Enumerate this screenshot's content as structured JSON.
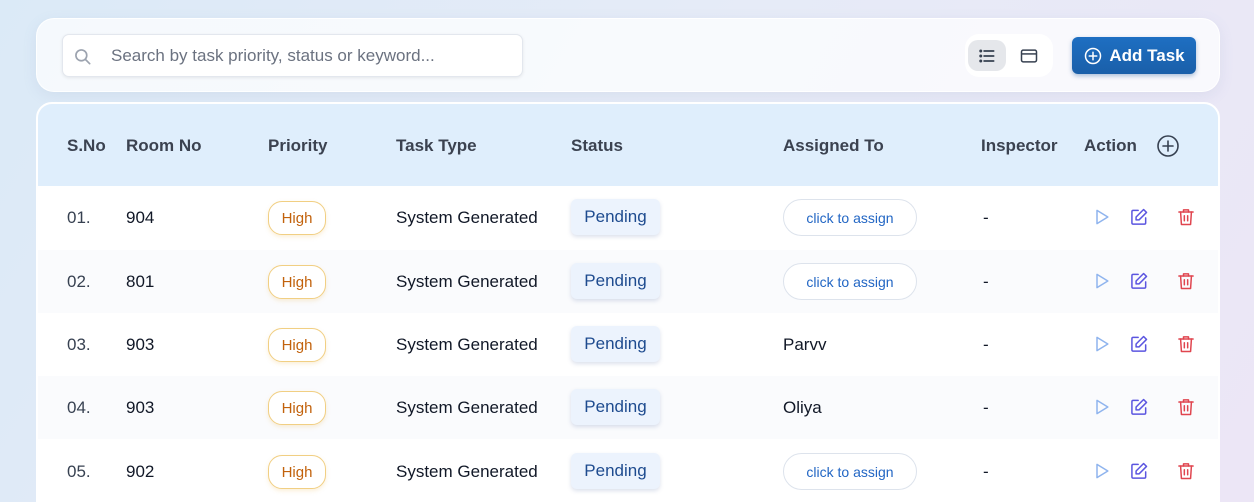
{
  "search": {
    "placeholder": "Search by task priority, status or keyword..."
  },
  "toolbar": {
    "add_label": "Add Task"
  },
  "table": {
    "headers": {
      "sno": "S.No",
      "room": "Room No",
      "priority": "Priority",
      "task_type": "Task Type",
      "status": "Status",
      "assigned": "Assigned To",
      "inspector": "Inspector",
      "action": "Action"
    },
    "rows": [
      {
        "sno": "01.",
        "room": "904",
        "priority": "High",
        "task_type": "System Generated",
        "status": "Pending",
        "assigned": "click to assign",
        "assigned_is_button": true,
        "inspector": "-"
      },
      {
        "sno": "02.",
        "room": "801",
        "priority": "High",
        "task_type": "System Generated",
        "status": "Pending",
        "assigned": "click to assign",
        "assigned_is_button": true,
        "inspector": "-"
      },
      {
        "sno": "03.",
        "room": "903",
        "priority": "High",
        "task_type": "System Generated",
        "status": "Pending",
        "assigned": "Parvv",
        "assigned_is_button": false,
        "inspector": "-"
      },
      {
        "sno": "04.",
        "room": "903",
        "priority": "High",
        "task_type": "System Generated",
        "status": "Pending",
        "assigned": "Oliya",
        "assigned_is_button": false,
        "inspector": "-"
      },
      {
        "sno": "05.",
        "room": "902",
        "priority": "High",
        "task_type": "System Generated",
        "status": "Pending",
        "assigned": "click to assign",
        "assigned_is_button": true,
        "inspector": "-"
      }
    ]
  },
  "icons": {
    "search": "search-icon",
    "list_view": "list-view-icon",
    "card_view": "card-view-icon",
    "add": "plus-circle-icon",
    "play": "play-icon",
    "edit": "edit-icon",
    "delete": "trash-icon"
  },
  "colors": {
    "accent": "#1a63b3",
    "priority_high": "#c2620c",
    "status_pending": "#1e4b8f",
    "play": "#8fb4ee",
    "edit": "#5b55e0",
    "delete": "#e0454f"
  }
}
